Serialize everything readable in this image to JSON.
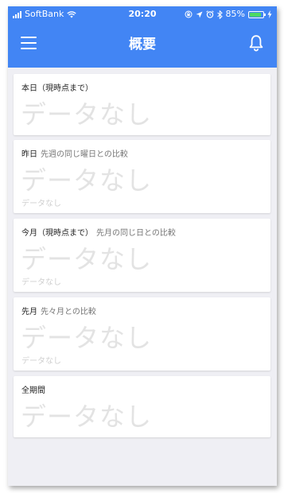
{
  "status_bar": {
    "carrier": "SoftBank",
    "time": "20:20",
    "battery": "85%",
    "battery_level": 0.85,
    "icons": [
      "signal-icon",
      "wifi-icon",
      "lock-rotation-icon",
      "location-icon",
      "alarm-icon",
      "bluetooth-icon",
      "battery-icon",
      "charging-icon"
    ]
  },
  "nav": {
    "title": "概要",
    "icons": [
      "menu-icon",
      "bell-icon"
    ]
  },
  "cards": [
    {
      "title": "本日（現時点まで）",
      "subtitle": "",
      "value": "データなし",
      "compare": ""
    },
    {
      "title": "昨日",
      "subtitle": "先週の同じ曜日との比較",
      "value": "データなし",
      "compare": "データなし"
    },
    {
      "title": "今月（現時点まで）",
      "subtitle": "先月の同じ日との比較",
      "value": "データなし",
      "compare": "データなし"
    },
    {
      "title": "先月",
      "subtitle": "先々月との比較",
      "value": "データなし",
      "compare": "データなし"
    },
    {
      "title": "全期間",
      "subtitle": "",
      "value": "データなし",
      "compare": ""
    }
  ],
  "colors": {
    "header_blue": "#4285f4",
    "background": "#efeff4",
    "placeholder_text": "#e3e3e3",
    "battery_green": "#4cd964"
  }
}
